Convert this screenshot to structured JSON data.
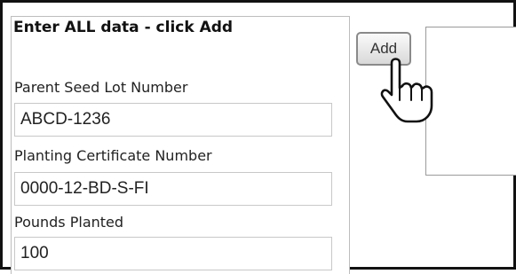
{
  "form": {
    "heading": "Enter ALL data - click Add",
    "fields": [
      {
        "label": "Parent Seed Lot Number",
        "value": "ABCD-1236"
      },
      {
        "label": "Planting Certificate Number",
        "value": "0000-12-BD-S-FI"
      },
      {
        "label": "Pounds Planted",
        "value": "100"
      }
    ]
  },
  "actions": {
    "add_label": "Add"
  },
  "icons": {
    "cursor": "hand-pointer-icon"
  }
}
